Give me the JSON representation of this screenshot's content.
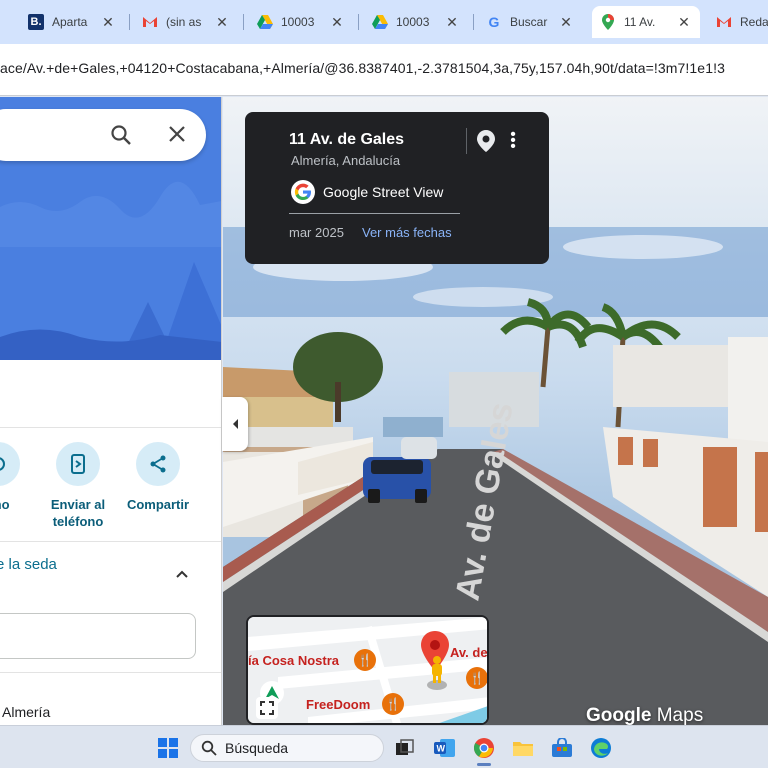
{
  "browser": {
    "tabs": [
      {
        "label": "Aparta",
        "icon": "booking-icon",
        "active": false
      },
      {
        "label": "(sin as",
        "icon": "gmail-icon",
        "active": false
      },
      {
        "label": "10003",
        "icon": "drive-icon",
        "active": false
      },
      {
        "label": "10003",
        "icon": "drive-icon",
        "active": false
      },
      {
        "label": "Buscar",
        "icon": "google-icon",
        "active": false
      },
      {
        "label": "11 Av.",
        "icon": "maps-pin-icon",
        "active": true
      },
      {
        "label": "Reda",
        "icon": "gmail-icon",
        "active": false
      }
    ],
    "url": "ace/Av.+de+Gales,+04120+Costacabana,+Almería/@36.8387401,-2.3781504,3a,75y,157.04h,90t/data=!3m7!1e1!3"
  },
  "left_panel": {
    "actions": [
      {
        "label_line1": "ano",
        "label_line2": "",
        "icon": "target-icon"
      },
      {
        "label_line1": "Enviar al",
        "label_line2": "teléfono",
        "icon": "send-to-phone-icon"
      },
      {
        "label_line1": "Compartir",
        "label_line2": "",
        "icon": "share-icon"
      }
    ],
    "section_title": "e la seda",
    "address_line": "Almería"
  },
  "street_view": {
    "card_title": "11 Av. de Gales",
    "card_subtitle": "Almería, Andalucía",
    "brand": "Google Street View",
    "date": "mar 2025",
    "more_dates": "Ver más fechas",
    "street_sign": "Av. de Gales",
    "watermark_google": "Google",
    "watermark_maps": "Maps"
  },
  "minimap": {
    "labels": [
      "ía Cosa Nostra",
      "Av. de",
      "FreeDoom"
    ]
  },
  "taskbar": {
    "search_text": "Búsqueda"
  },
  "colors": {
    "accent_blue": "#4a7fe0",
    "teal_text": "#0b6e8e",
    "card_bg": "#202124",
    "link_blue": "#8ab4f8"
  }
}
